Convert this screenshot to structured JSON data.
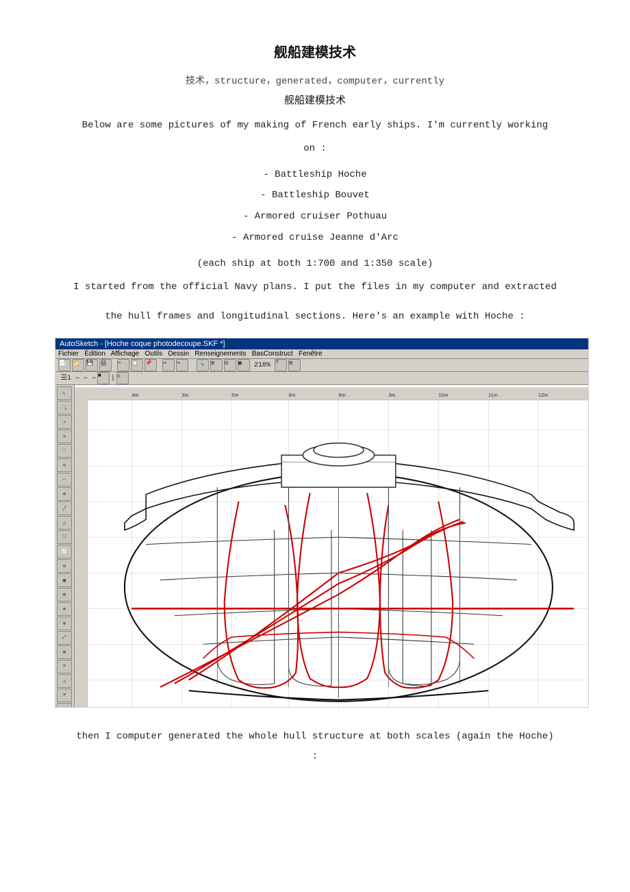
{
  "page": {
    "title": "舰船建模技术",
    "keywords": "技术，structure，generated，computer，currently",
    "subtitle": "舰船建模技术",
    "intro_line1": "Below are some pictures of my making of French early ships.  I'm currently working",
    "intro_line2": "on :",
    "ships": [
      "- Battleship Hoche",
      "- Battleship Bouvet",
      "- Armored cruiser Pothuau",
      "- Armored cruise Jeanne d'Arc"
    ],
    "scale_note": "(each ship at both 1:700 and 1:350 scale)",
    "body_text1": "I started from the official Navy plans.  I put the files in my computer and extracted",
    "body_text2": "the hull frames and longitudinal sections.  Here's an example with Hoche :",
    "window_title": "AutoSketch - [Hoche coque photodecoupe.SKF *]",
    "footer_text1": "then I computer generated the whole hull structure at both scales (again the Hoche)",
    "footer_text2": ":"
  }
}
